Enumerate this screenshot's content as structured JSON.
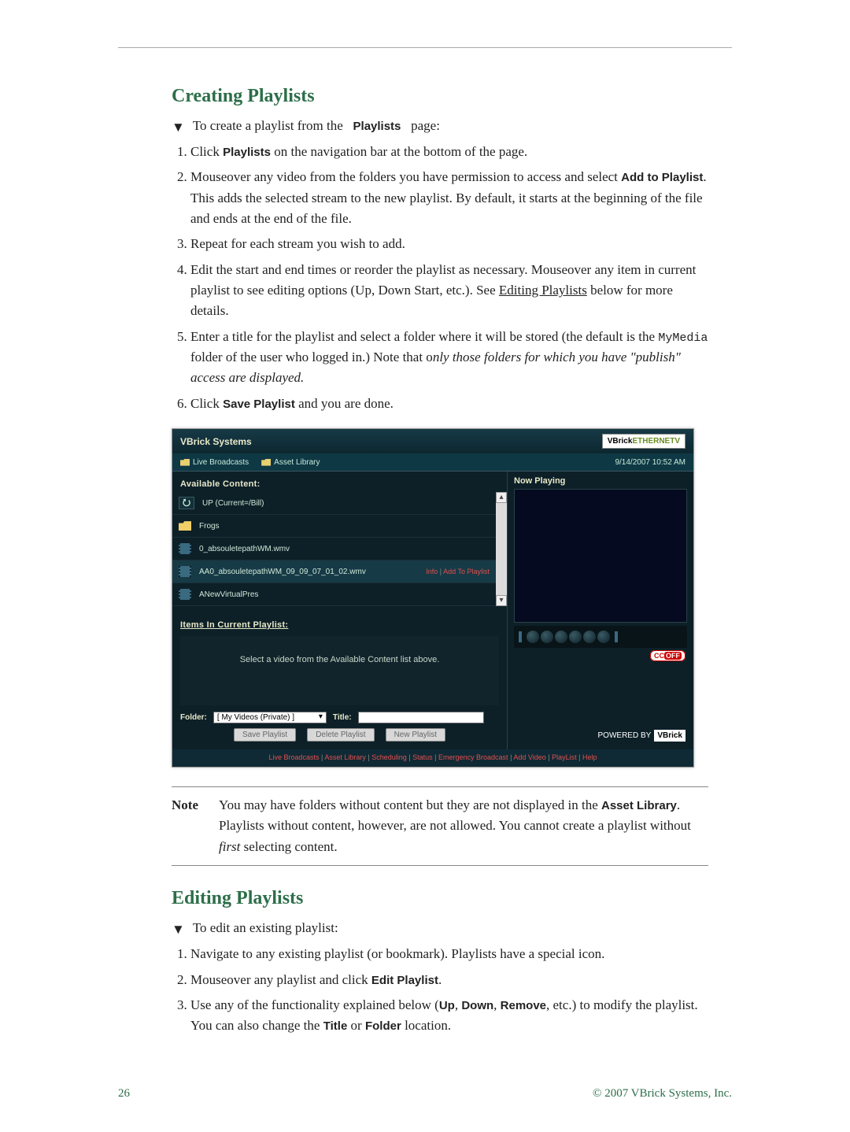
{
  "section1": {
    "title": "Creating Playlists",
    "intro": "To create a playlist from the",
    "intro_bold": "Playlists",
    "intro_tail": "page:",
    "steps": [
      {
        "pre": "Click ",
        "bold": "Playlists",
        "post": " on the navigation bar at the bottom of the page."
      },
      {
        "pre": "Mouseover any video from the folders you have permission to access and select ",
        "bold": "Add to Playlist",
        "post": ". This adds the selected stream to the new playlist. By default, it starts at the beginning of the file and ends at the end of the file."
      },
      {
        "text": "Repeat for each stream you wish to add."
      },
      {
        "pre": "Edit the start and end times or reorder the playlist as necessary. Mouseover any item in current playlist to see editing options (Up, Down Start, etc.). See ",
        "ul": "Editing Playlists",
        "post": " below for more details."
      },
      {
        "pre": "Enter a title for the playlist and select a folder where it will be stored (the default is the ",
        "mono": "MyMedia",
        "mid": " folder of the user who logged in.) Note that o",
        "ital": "nly those folders for which you have \"publish\" access are displayed.",
        "post": ""
      },
      {
        "pre": "Click ",
        "bold": "Save Playlist",
        "post": " and you are done."
      }
    ]
  },
  "app": {
    "company": "VBrick Systems",
    "logo_vb": "VBrick",
    "logo_et": "ETHERNETV",
    "tabs": {
      "live": "Live Broadcasts",
      "asset": "Asset Library"
    },
    "timestamp": "9/14/2007 10:52 AM",
    "available": "Available Content:",
    "now_playing": "Now Playing",
    "rows": [
      {
        "icon": "up",
        "label": "UP (Current=/Bill)"
      },
      {
        "icon": "folder",
        "label": "Frogs"
      },
      {
        "icon": "film",
        "label": "0_absouletepathWM.wmv"
      },
      {
        "icon": "film",
        "label": "AA0_absouletepathWM_09_09_07_01_02.wmv",
        "hover": true,
        "info": "Info",
        "add": "Add To Playlist"
      },
      {
        "icon": "film",
        "label": "ANewVirtualPres"
      }
    ],
    "items_label": "Items In Current Playlist:",
    "playlist_msg": "Select a video from the Available Content list above.",
    "folder_label": "Folder:",
    "folder_value": "[ My Videos (Private) ]",
    "title_label": "Title:",
    "title_value": "",
    "btns": {
      "save": "Save Playlist",
      "delete": "Delete Playlist",
      "new": "New Playlist"
    },
    "cc": "CC",
    "cc_off": "OFF",
    "powered": "POWERED BY",
    "pb_logo": "VBrick",
    "footer_links": [
      "Live Broadcasts",
      "Asset Library",
      "Scheduling",
      "Status",
      "Emergency Broadcast",
      "Add Video",
      "PlayList",
      "Help"
    ]
  },
  "note": {
    "label": "Note",
    "pre": "You may have folders without content but they are not displayed in the ",
    "bold": "Asset Library",
    "mid": ". Playlists without content, however, are not allowed. You cannot create a playlist without ",
    "ital": "first",
    "post": " selecting content."
  },
  "section2": {
    "title": "Editing Playlists",
    "intro": "To edit an existing playlist:",
    "steps": [
      {
        "text": "Navigate to any existing playlist (or bookmark). Playlists have a special icon."
      },
      {
        "pre": "Mouseover any playlist and click ",
        "bold": "Edit Playlist",
        "post": "."
      },
      {
        "pre": "Use any of the functionality explained below (",
        "b1": "Up",
        "s1": ", ",
        "b2": "Down",
        "s2": ", ",
        "b3": "Remove",
        "mid": ", etc.) to modify the playlist. You can also change the ",
        "b4": "Title",
        "s3": " or ",
        "b5": "Folder",
        "post": " location."
      }
    ]
  },
  "footer": {
    "page": "26",
    "copy": "© 2007 VBrick Systems, Inc."
  }
}
